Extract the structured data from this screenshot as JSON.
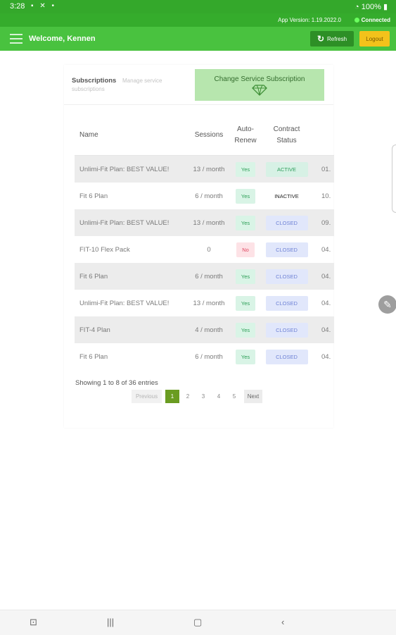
{
  "status_bar": {
    "time": "3:28",
    "battery": "100%"
  },
  "version_bar": {
    "version": "App Version: 1.19.2022.0",
    "connection": "Connected"
  },
  "header": {
    "welcome": "Welcome, Kennen",
    "refresh_label": "Refresh",
    "logout_label": "Logout"
  },
  "card": {
    "title": "Subscriptions",
    "subtitle_1": "Manage service",
    "subtitle_2": "subscriptions",
    "change_button": "Change Service Subscription"
  },
  "table": {
    "headers": {
      "name": "Name",
      "sessions": "Sessions",
      "auto_renew_1": "Auto-",
      "auto_renew_2": "Renew",
      "contract_1": "Contract",
      "contract_2": "Status"
    },
    "rows": [
      {
        "name": "Unlimi-Fit Plan: BEST VALUE!",
        "sessions": "13 / month",
        "auto_renew": "Yes",
        "status": "ACTIVE",
        "date": "01."
      },
      {
        "name": "Fit 6 Plan",
        "sessions": "6 / month",
        "auto_renew": "Yes",
        "status": "INACTIVE",
        "date": "10."
      },
      {
        "name": "Unlimi-Fit Plan: BEST VALUE!",
        "sessions": "13 / month",
        "auto_renew": "Yes",
        "status": "CLOSED",
        "date": "09."
      },
      {
        "name": "FIT-10 Flex Pack",
        "sessions": "0",
        "auto_renew": "No",
        "status": "CLOSED",
        "date": "04."
      },
      {
        "name": "Fit 6 Plan",
        "sessions": "6 / month",
        "auto_renew": "Yes",
        "status": "CLOSED",
        "date": "04."
      },
      {
        "name": "Unlimi-Fit Plan: BEST VALUE!",
        "sessions": "13 / month",
        "auto_renew": "Yes",
        "status": "CLOSED",
        "date": "04."
      },
      {
        "name": "FIT-4 Plan",
        "sessions": "4 / month",
        "auto_renew": "Yes",
        "status": "CLOSED",
        "date": "04."
      },
      {
        "name": "Fit 6 Plan",
        "sessions": "6 / month",
        "auto_renew": "Yes",
        "status": "CLOSED",
        "date": "04."
      }
    ]
  },
  "pagination": {
    "showing": "Showing 1 to 8 of 36 entries",
    "previous": "Previous",
    "pages": [
      "1",
      "2",
      "3",
      "4",
      "5"
    ],
    "current": "1",
    "next": "Next"
  },
  "colors": {
    "status_bar": "#34a82b",
    "header": "#49c23f",
    "refresh": "#2d8f26",
    "logout": "#f3c21b",
    "current_page": "#6a9c21"
  },
  "icons": [
    "hamburger-icon",
    "refresh-icon",
    "diamond-icon",
    "pencil-icon",
    "screenshot-icon",
    "recent-apps-icon",
    "home-icon",
    "back-icon"
  ]
}
